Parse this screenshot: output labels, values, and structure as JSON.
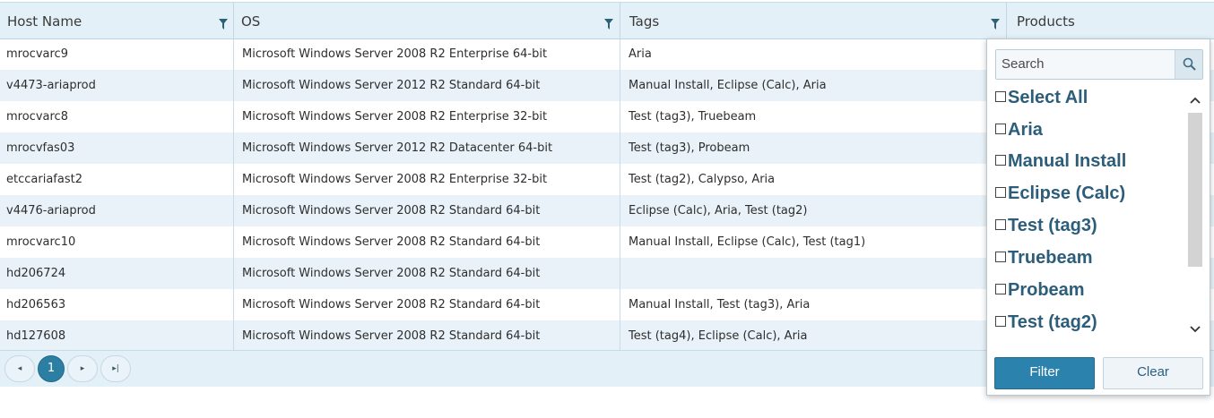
{
  "columns": {
    "host_name": "Host Name",
    "os": "OS",
    "tags": "Tags",
    "products": "Products"
  },
  "rows": [
    {
      "host": "mrocvarc9",
      "os": "Microsoft Windows Server 2008 R2 Enterprise 64-bit",
      "tags": "Aria"
    },
    {
      "host": "v4473-ariaprod",
      "os": "Microsoft Windows Server 2012 R2 Standard 64-bit",
      "tags": "Manual Install, Eclipse (Calc), Aria"
    },
    {
      "host": "mrocvarc8",
      "os": "Microsoft Windows Server 2008 R2 Enterprise 32-bit",
      "tags": "Test (tag3), Truebeam"
    },
    {
      "host": "mrocvfas03",
      "os": "Microsoft Windows Server 2012 R2 Datacenter 64-bit",
      "tags": "Test (tag3), Probeam"
    },
    {
      "host": "etccariafast2",
      "os": "Microsoft Windows Server 2008 R2 Enterprise 32-bit",
      "tags": "Test (tag2), Calypso, Aria"
    },
    {
      "host": "v4476-ariaprod",
      "os": "Microsoft Windows Server 2008 R2 Standard 64-bit",
      "tags": "Eclipse (Calc), Aria, Test (tag2)"
    },
    {
      "host": "mrocvarc10",
      "os": "Microsoft Windows Server 2008 R2 Standard 64-bit",
      "tags": "Manual Install, Eclipse (Calc), Test (tag1)"
    },
    {
      "host": "hd206724",
      "os": "Microsoft Windows Server 2008 R2 Standard 64-bit",
      "tags": ""
    },
    {
      "host": "hd206563",
      "os": "Microsoft Windows Server 2008 R2 Standard 64-bit",
      "tags": "Manual Install, Test (tag3), Aria"
    },
    {
      "host": "hd127608",
      "os": "Microsoft Windows Server 2008 R2 Standard 64-bit",
      "tags": "Test (tag4), Eclipse (Calc), Aria"
    }
  ],
  "pager": {
    "prev_icon": "◂",
    "current_page": "1",
    "next_icon": "▸",
    "last_icon": "▸|"
  },
  "filter_popup": {
    "search_placeholder": "Search",
    "options": [
      "Select All",
      "Aria",
      "Manual Install",
      "Eclipse (Calc)",
      "Test (tag3)",
      "Truebeam",
      "Probeam",
      "Test (tag2)"
    ],
    "filter_label": "Filter",
    "clear_label": "Clear"
  },
  "colors": {
    "header_bg": "#e3f0f7",
    "alt_row_bg": "#e8f2f8",
    "accent": "#2b83ad"
  }
}
